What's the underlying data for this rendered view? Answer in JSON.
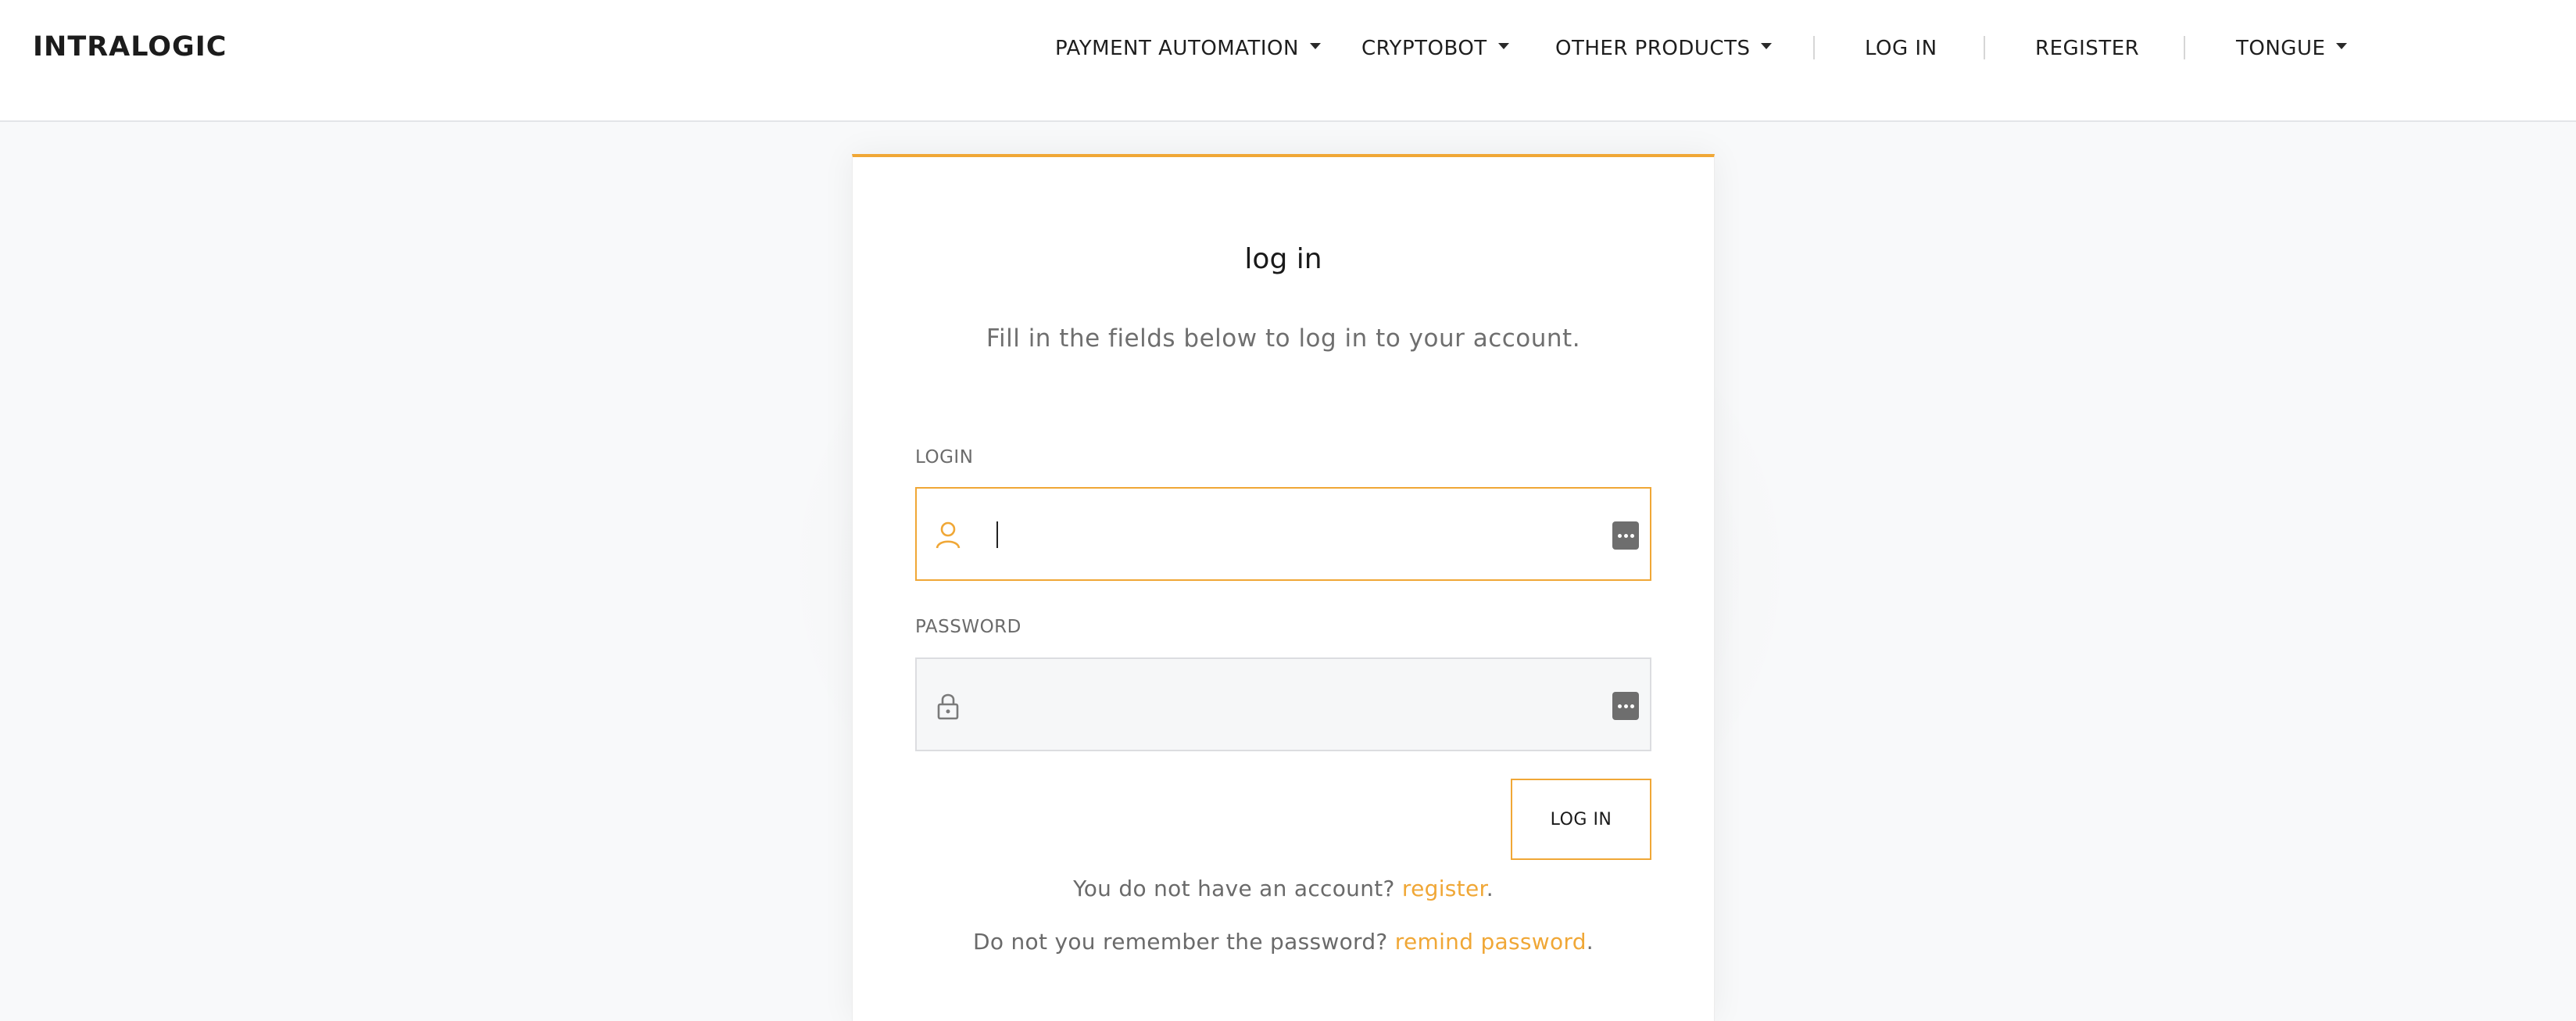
{
  "header": {
    "brand": "INTRALOGIC",
    "nav": {
      "payment_automation": "PAYMENT AUTOMATION",
      "cryptobot": "CRYPTOBOT",
      "other_products": "OTHER PRODUCTS",
      "log_in": "LOG IN",
      "register": "REGISTER",
      "tongue": "TONGUE"
    }
  },
  "card": {
    "title": "log in",
    "subtitle": "Fill in the fields below to log in to your account.",
    "login": {
      "label": "LOGIN",
      "value": "",
      "icon": "user-icon",
      "autofill_icon": "password-manager-icon"
    },
    "password": {
      "label": "PASSWORD",
      "value": "",
      "icon": "lock-icon",
      "autofill_icon": "password-manager-icon"
    },
    "submit_label": "LOG IN",
    "register_prompt": "You do not have an account?",
    "register_link": "register",
    "remind_prompt": "Do not you remember the password?",
    "remind_link": "remind password",
    "period": "."
  },
  "colors": {
    "accent": "#f0a736",
    "background": "#f8f9fa"
  }
}
